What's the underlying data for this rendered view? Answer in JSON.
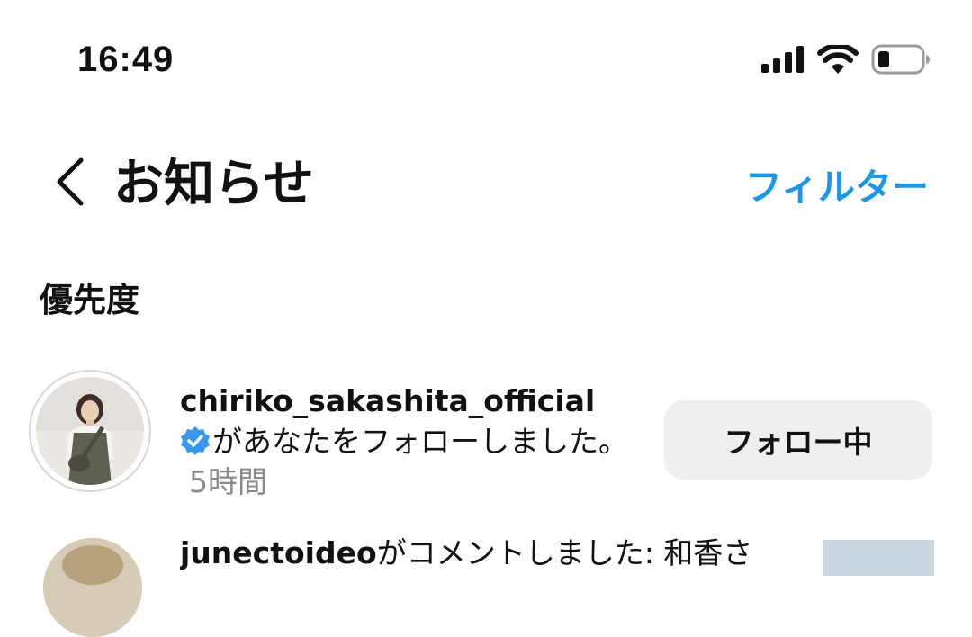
{
  "status_bar": {
    "time": "16:49",
    "icons": [
      "cellular-signal-icon",
      "wifi-icon",
      "battery-low-icon"
    ]
  },
  "header": {
    "back_icon": "chevron-left-icon",
    "title": "お知らせ",
    "filter_label": "フィルター"
  },
  "colors": {
    "accent": "#1a96ea",
    "verified": "#3897f0",
    "button_bg": "#efefef",
    "muted_text": "#8a8a8a"
  },
  "section": {
    "heading": "優先度"
  },
  "notifications": [
    {
      "username": "chiriko_sakashita_official",
      "verified": true,
      "message": "があなたをフォローしました。",
      "time": "5時間",
      "button_label": "フォロー中"
    },
    {
      "username": "junectoideo",
      "message": "がコメントしました: 和香さ"
    }
  ]
}
